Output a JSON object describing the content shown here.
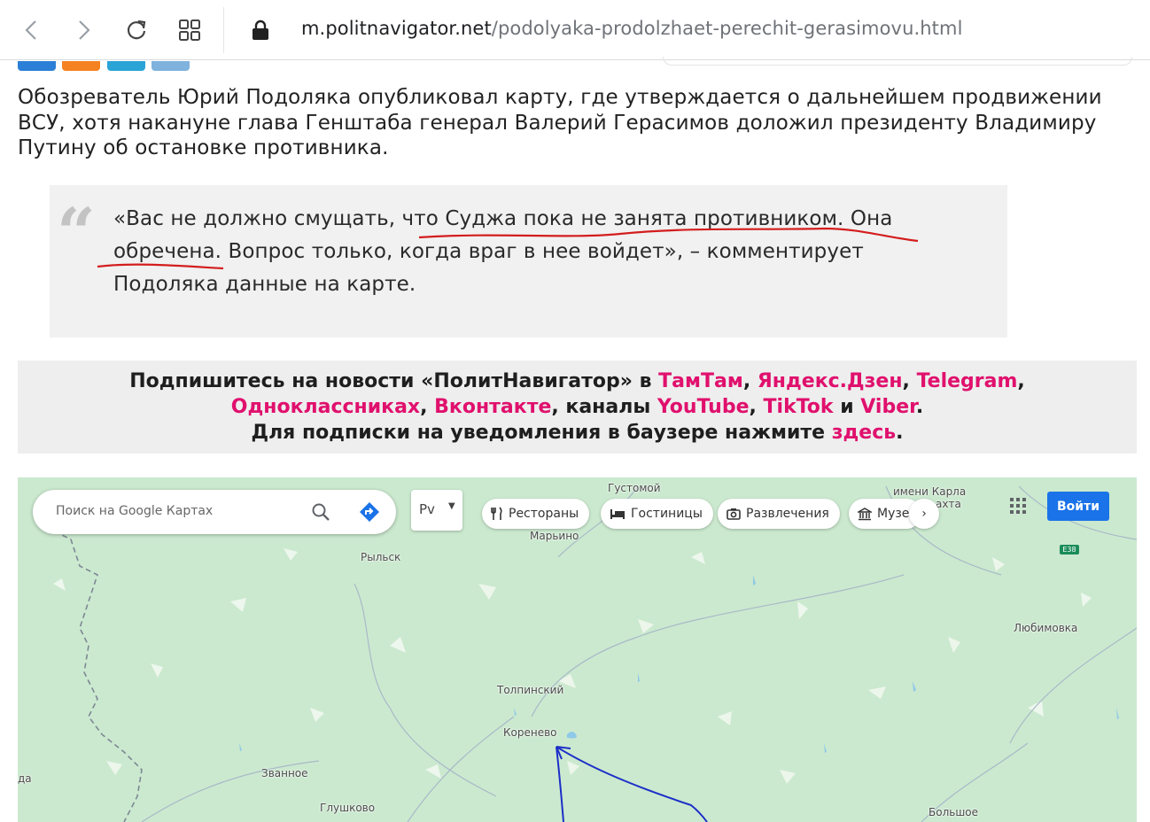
{
  "browser": {
    "url_host": "m.politnavigator.net",
    "url_path": "/podolyaka-prodolzhaet-perechit-gerasimovu.html"
  },
  "article": {
    "intro": "Обозреватель Юрий Подоляка опубликовал карту, где утверждается о дальнейшем продвижении ВСУ, хотя накануне глава Генштаба генерал Валерий Герасимов доложил президенту Владимиру Путину об остановке противника.",
    "quote_mark": "“",
    "quote_line1": "«Вас не должно смущать, что Суджа пока не занята противником. Она",
    "quote_line2": "обречена. Вопрос только, когда враг в нее войдет», – комментирует",
    "quote_line3": "Подоляка данные на карте."
  },
  "subscribe": {
    "text1": "Подпишитесь на новости «ПолитНавигатор» в ",
    "tamtam": "ТамТам",
    "sep1": ", ",
    "yandex": "Яндекс.Дзен",
    "sep2": ", ",
    "telegram": "Telegram",
    "sep3": ",",
    "odnoklassniki": "Одноклассниках",
    "sep4": ", ",
    "vkontakte": "Вконтакте",
    "text2": ", каналы ",
    "youtube": "YouTube",
    "sep5": ", ",
    "tiktok": "TikTok",
    "text3": " и ",
    "viber": "Viber",
    "text4": ".",
    "text5": "Для подписки на уведомления в баузере нажмите ",
    "here": "здесь",
    "text6": "."
  },
  "map": {
    "search_placeholder": "Поиск на Google Картах",
    "lang_label": "Рv",
    "chips": [
      "Рестораны",
      "Гостиницы",
      "Развлечения",
      "Музе"
    ],
    "next_arrow": "›",
    "login": "Войти",
    "road_badge": "E38",
    "labels": {
      "gustomoy": "Густомой",
      "karla": "имени Карла",
      "karla2": "ахта",
      "marino": "Марьино",
      "rylsk": "Рыльск",
      "lyubimovka": "Любимовка",
      "tolpinsky": "Толпинский",
      "korenevo": "Коренево",
      "zvannoe": "Званное",
      "glushkovo": "Глушково",
      "bolshoe": "Большое",
      "da": "да"
    }
  },
  "colors": {
    "link": "#e0106d",
    "underline": "#d41d1d",
    "map_bg": "#cbe9cf",
    "arrow": "#1c2fc7",
    "share_blue": "#2b7fd6",
    "share_orange": "#f58220",
    "share_sky": "#2aa3d6",
    "share_pale": "#7fb2dd"
  }
}
